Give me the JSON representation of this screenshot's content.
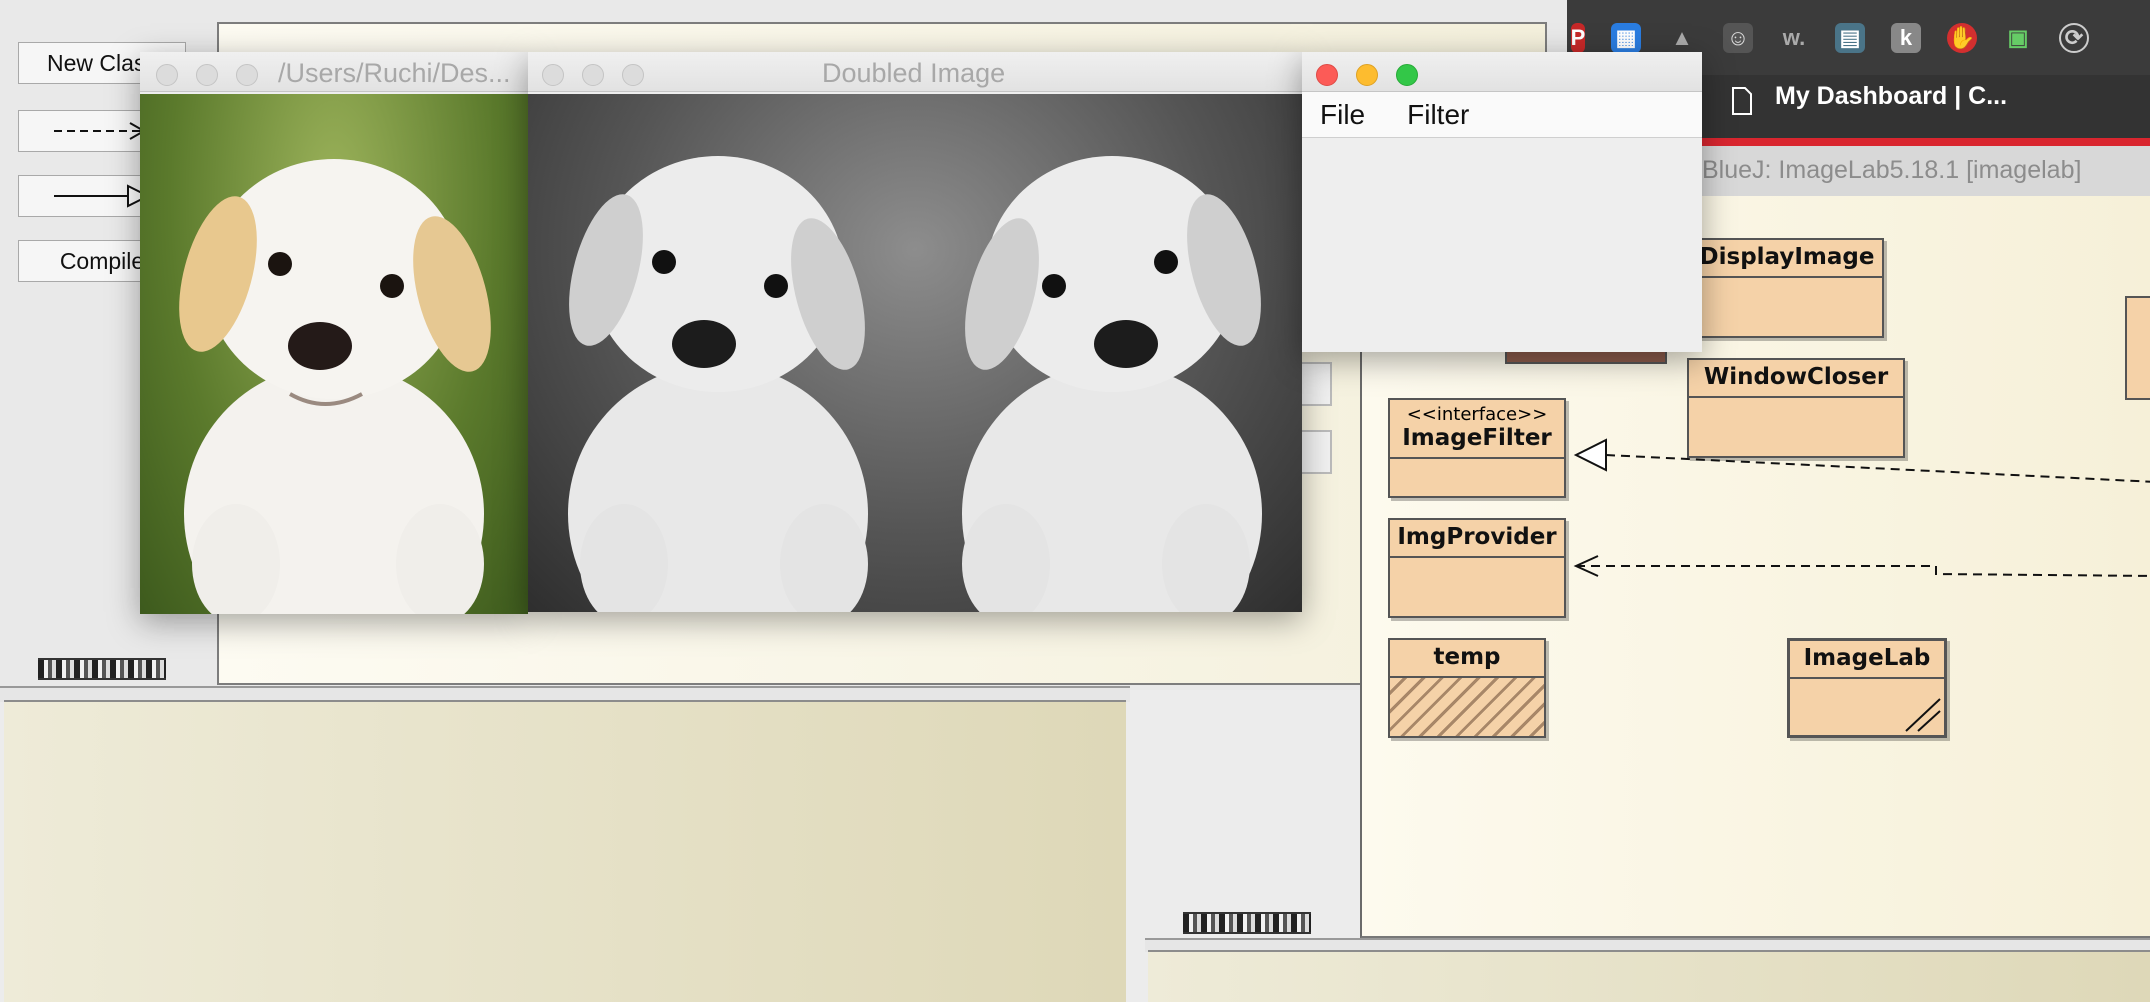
{
  "left_toolbar": {
    "new_class": "New Class",
    "dependency_arrow": "dashed-arrow-icon",
    "inherit_arrow": "solid-arrow-icon",
    "compile": "Compile"
  },
  "browser": {
    "tab_title": "My Dashboard | C...",
    "extensions": [
      "p-icon",
      "drive-files-icon",
      "google-drive-icon",
      "ghost-icon",
      "w-icon",
      "calendar-icon",
      "k-icon",
      "stop-hand-icon",
      "screen-icon",
      "refresh-icon"
    ]
  },
  "bluej": {
    "window_title": "BlueJ:  ImageLab5.18.1  [imagelab]",
    "classes": [
      {
        "name": "DisplayImage"
      },
      {
        "name": "WindowCloser"
      },
      {
        "stereotype": "<<interface>>",
        "name": "ImageFilter"
      },
      {
        "name": "ImgProvider"
      },
      {
        "name": "temp"
      },
      {
        "name": "ImageLab"
      }
    ]
  },
  "windows": {
    "original": {
      "title": "/Users/Ruchi/Des..."
    },
    "doubled": {
      "title": "Doubled Image"
    },
    "menu": {
      "items": [
        "File",
        "Filter"
      ]
    }
  },
  "colors": {
    "class_fill": "#f5d2a8",
    "canvas": "#fbf7e6",
    "close": "#fc5b57",
    "minimize": "#fdbc2f",
    "zoom": "#33c748",
    "accent_red": "#d9262f"
  }
}
